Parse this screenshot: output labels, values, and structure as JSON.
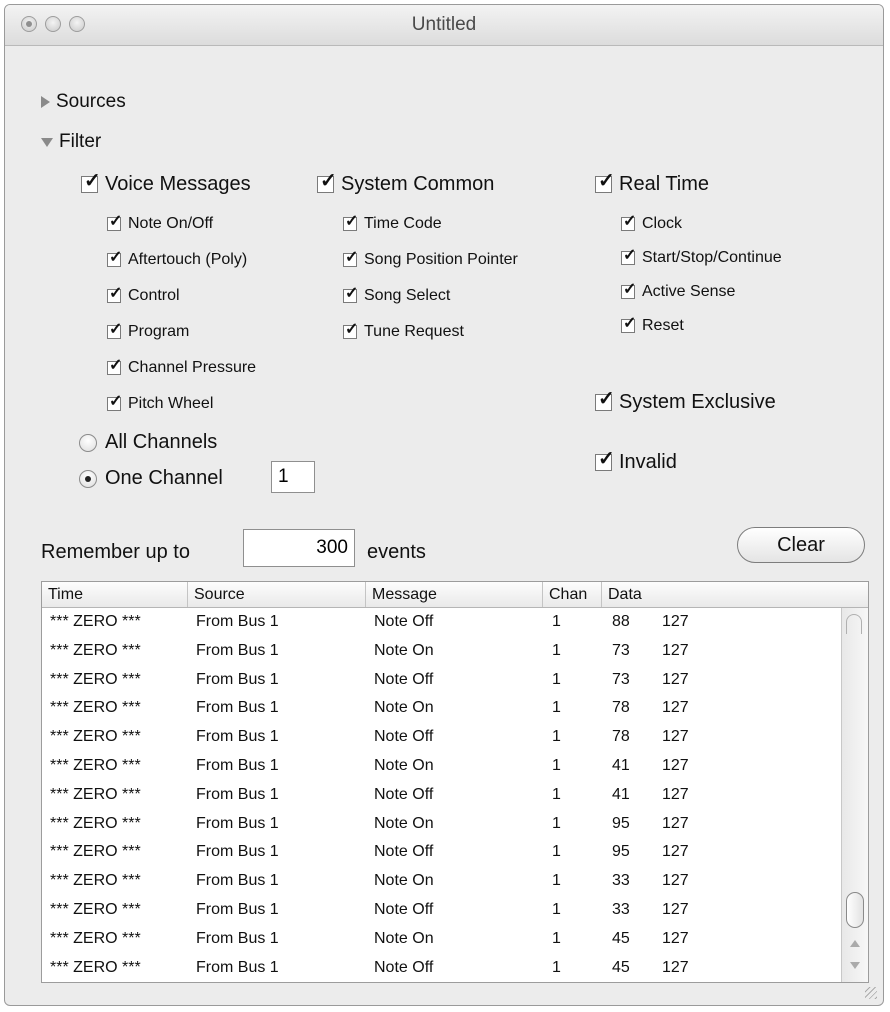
{
  "window": {
    "title": "Untitled"
  },
  "sections": {
    "sources_label": "Sources",
    "filter_label": "Filter"
  },
  "voice": {
    "header": "Voice Messages",
    "items": [
      "Note On/Off",
      "Aftertouch (Poly)",
      "Control",
      "Program",
      "Channel Pressure",
      "Pitch Wheel"
    ]
  },
  "system_common": {
    "header": "System Common",
    "items": [
      "Time Code",
      "Song Position Pointer",
      "Song Select",
      "Tune Request"
    ]
  },
  "real_time": {
    "header": "Real Time",
    "items": [
      "Clock",
      "Start/Stop/Continue",
      "Active Sense",
      "Reset"
    ]
  },
  "extra": {
    "sysex": "System Exclusive",
    "invalid": "Invalid"
  },
  "channels": {
    "all": "All Channels",
    "one": "One Channel",
    "one_value": "1",
    "selected": "one"
  },
  "history": {
    "prefix": "Remember up to",
    "value": "300",
    "suffix": "events",
    "clear": "Clear"
  },
  "table": {
    "columns": [
      "Time",
      "Source",
      "Message",
      "Chan",
      "Data"
    ],
    "rows": [
      [
        "*** ZERO ***",
        "From Bus 1",
        "Note Off",
        "1",
        "88",
        "127"
      ],
      [
        "*** ZERO ***",
        "From Bus 1",
        "Note On",
        "1",
        "73",
        "127"
      ],
      [
        "*** ZERO ***",
        "From Bus 1",
        "Note Off",
        "1",
        "73",
        "127"
      ],
      [
        "*** ZERO ***",
        "From Bus 1",
        "Note On",
        "1",
        "78",
        "127"
      ],
      [
        "*** ZERO ***",
        "From Bus 1",
        "Note Off",
        "1",
        "78",
        "127"
      ],
      [
        "*** ZERO ***",
        "From Bus 1",
        "Note On",
        "1",
        "41",
        "127"
      ],
      [
        "*** ZERO ***",
        "From Bus 1",
        "Note Off",
        "1",
        "41",
        "127"
      ],
      [
        "*** ZERO ***",
        "From Bus 1",
        "Note On",
        "1",
        "95",
        "127"
      ],
      [
        "*** ZERO ***",
        "From Bus 1",
        "Note Off",
        "1",
        "95",
        "127"
      ],
      [
        "*** ZERO ***",
        "From Bus 1",
        "Note On",
        "1",
        "33",
        "127"
      ],
      [
        "*** ZERO ***",
        "From Bus 1",
        "Note Off",
        "1",
        "33",
        "127"
      ],
      [
        "*** ZERO ***",
        "From Bus 1",
        "Note On",
        "1",
        "45",
        "127"
      ],
      [
        "*** ZERO ***",
        "From Bus 1",
        "Note Off",
        "1",
        "45",
        "127"
      ]
    ]
  },
  "icons": {
    "checkmark": "check-icon",
    "sources_toggle": "disclosure-collapsed-icon",
    "filter_toggle": "disclosure-expanded-icon"
  }
}
